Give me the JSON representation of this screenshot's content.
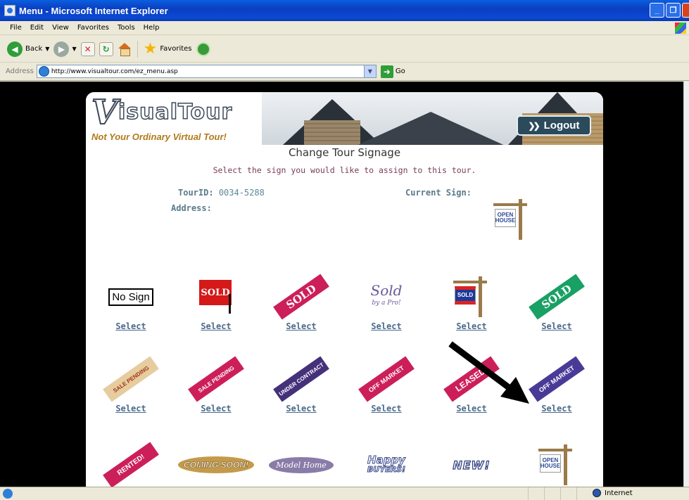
{
  "window": {
    "title": "Menu - Microsoft Internet Explorer",
    "buttons": [
      "_",
      "❐",
      "✕"
    ]
  },
  "menubar": [
    "File",
    "Edit",
    "View",
    "Favorites",
    "Tools",
    "Help"
  ],
  "toolbar": {
    "back_label": "Back",
    "favorites_label": "Favorites"
  },
  "addressbar": {
    "label": "Address",
    "url": "http://www.visualtour.com/ez_menu.asp",
    "go_label": "Go"
  },
  "site": {
    "logo_v": "V",
    "logo_word": "isualTour",
    "tagline": "Not Your Ordinary Virtual Tour!",
    "logout_label": "Logout",
    "page_title": "Change Tour Signage",
    "instructions": "Select the sign you would like to assign to this tour.",
    "tourid_label": "TourID:",
    "tourid_value": "0034-5288",
    "address_label": "Address:",
    "current_sign_label": "Current Sign:",
    "current_sign_text": "OPEN HOUSE"
  },
  "signs": {
    "select_label": "Select",
    "row1": [
      "No Sign",
      "SOLD",
      "SOLD",
      "Sold",
      "SOLD",
      "SOLD"
    ],
    "sold_by_pro_sub": "by a Pro!",
    "row2": [
      "SALE PENDING",
      "SALE PENDING",
      "UNDER CONTRACT",
      "OFF MARKET",
      "LEASED!",
      "OFF MARKET"
    ],
    "row3": [
      "RENTED!",
      "COMING SOON!",
      "Model Home",
      "Happy",
      "NEW!",
      "OPEN HOUSE"
    ],
    "happy_sub": "BUYERS!"
  },
  "statusbar": {
    "zone": "Internet"
  }
}
